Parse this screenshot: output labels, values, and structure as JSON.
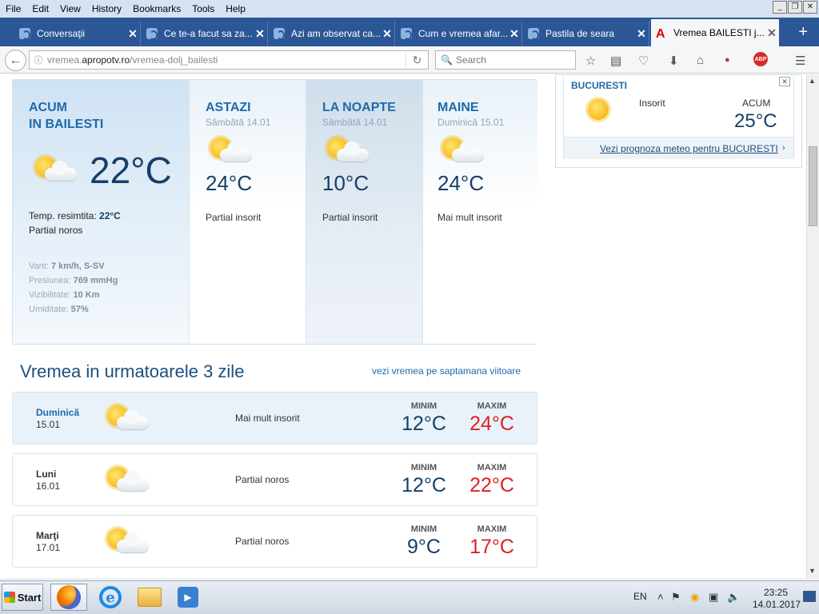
{
  "menu": [
    "File",
    "Edit",
    "View",
    "History",
    "Bookmarks",
    "Tools",
    "Help"
  ],
  "tabs": [
    {
      "label": "Conversaţii"
    },
    {
      "label": "Ce te-a facut sa za..."
    },
    {
      "label": "Azi am observat ca..."
    },
    {
      "label": "Cum e vremea afar..."
    },
    {
      "label": "Pastila de seara"
    },
    {
      "label": "Vremea BAILESTI j..."
    }
  ],
  "nav": {
    "url_pre": "vremea.",
    "url_host": "apropotv.ro",
    "url_path": "/vremea-dolj_bailesti",
    "search_placeholder": "Search"
  },
  "now": {
    "title1": "ACUM",
    "title2": "IN BAILESTI",
    "temp": "22°C",
    "felt_label": "Temp. resimtita:",
    "felt_value": "22°C",
    "desc": "Partial noros",
    "wind_label": "Vant:",
    "wind_value": "7 km/h, S-SV",
    "pressure_label": "Presiunea:",
    "pressure_value": "769 mmHg",
    "visibility_label": "Vizibilitate:",
    "visibility_value": "10 Km",
    "humidity_label": "Umiditate:",
    "humidity_value": "57%"
  },
  "periods": [
    {
      "title": "ASTAZI",
      "date": "Sâmbătă 14.01",
      "temp": "24°C",
      "desc": "Partial insorit"
    },
    {
      "title": "LA NOAPTE",
      "date": "Sâmbătă 14.01",
      "temp": "10°C",
      "desc": "Partial insorit"
    },
    {
      "title": "MAINE",
      "date": "Duminică 15.01",
      "temp": "24°C",
      "desc": "Mai mult insorit"
    }
  ],
  "days_title": "Vremea in urmatoarele 3 zile",
  "week_link": "vezi vremea pe saptamana viitoare",
  "min_label": "MINIM",
  "max_label": "MAXIM",
  "days": [
    {
      "name": "Duminică",
      "date": "15.01",
      "desc": "Mai mult insorit",
      "min": "12°C",
      "max": "24°C"
    },
    {
      "name": "Luni",
      "date": "16.01",
      "desc": "Partial noros",
      "min": "12°C",
      "max": "22°C"
    },
    {
      "name": "Marţi",
      "date": "17.01",
      "desc": "Partial noros",
      "min": "9°C",
      "max": "17°C"
    }
  ],
  "side": {
    "city": "BUCURESTI",
    "desc": "Insorit",
    "now_label": "ACUM",
    "temp": "25°C",
    "link": "Vezi prognoza meteo pentru BUCURESTI"
  },
  "taskbar": {
    "start": "Start",
    "lang": "EN",
    "time": "23:25",
    "date": "14.01.2017"
  },
  "icons": {
    "weather": "sun-cloud-icon",
    "side_weather": "sun-icon"
  }
}
